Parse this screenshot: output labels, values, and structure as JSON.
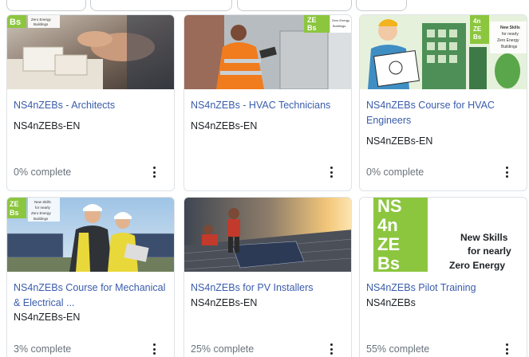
{
  "courses": [
    {
      "title": "NS4nZEBs - Architects",
      "category": "NS4nZEBs-EN",
      "progress_text": "0% complete",
      "progress": 0
    },
    {
      "title": "NS4nZEBs - HVAC Technicians",
      "category": "NS4nZEBs-EN",
      "progress_text": "",
      "progress": null
    },
    {
      "title": "NS4nZEBs Course for HVAC Engineers",
      "category": "NS4nZEBs-EN",
      "progress_text": "0% complete",
      "progress": 0
    },
    {
      "title": "NS4nZEBs Course for Mechanical & Electrical ...",
      "category": "NS4nZEBs-EN",
      "progress_text": "3% complete",
      "progress": 3
    },
    {
      "title": "NS4nZEBs for PV Installers",
      "category": "NS4nZEBs-EN",
      "progress_text": "25% complete",
      "progress": 25
    },
    {
      "title": "NS4nZEBs Pilot Training",
      "category": "NS4nZEBs",
      "progress_text": "55% complete",
      "progress": 55
    }
  ],
  "logo": {
    "mark_line1": "ZE",
    "mark_line2": "Bs",
    "tagline_small": [
      "New Skills",
      "for nearly",
      "Zero Energy",
      "Buildings"
    ],
    "tagline_small_2": [
      "Zero Energy",
      "Buildings"
    ],
    "big_mark": [
      "NS",
      "4n",
      "ZE",
      "Bs"
    ],
    "big_tagline": [
      "New Skills",
      "for nearly",
      "Zero Energy"
    ]
  },
  "colors": {
    "link": "#3a5cab",
    "logo_green": "#8cc63f",
    "text": "#1d2125",
    "muted": "#6a737b"
  },
  "icons": {
    "menu": "three-dots-vertical-icon"
  }
}
